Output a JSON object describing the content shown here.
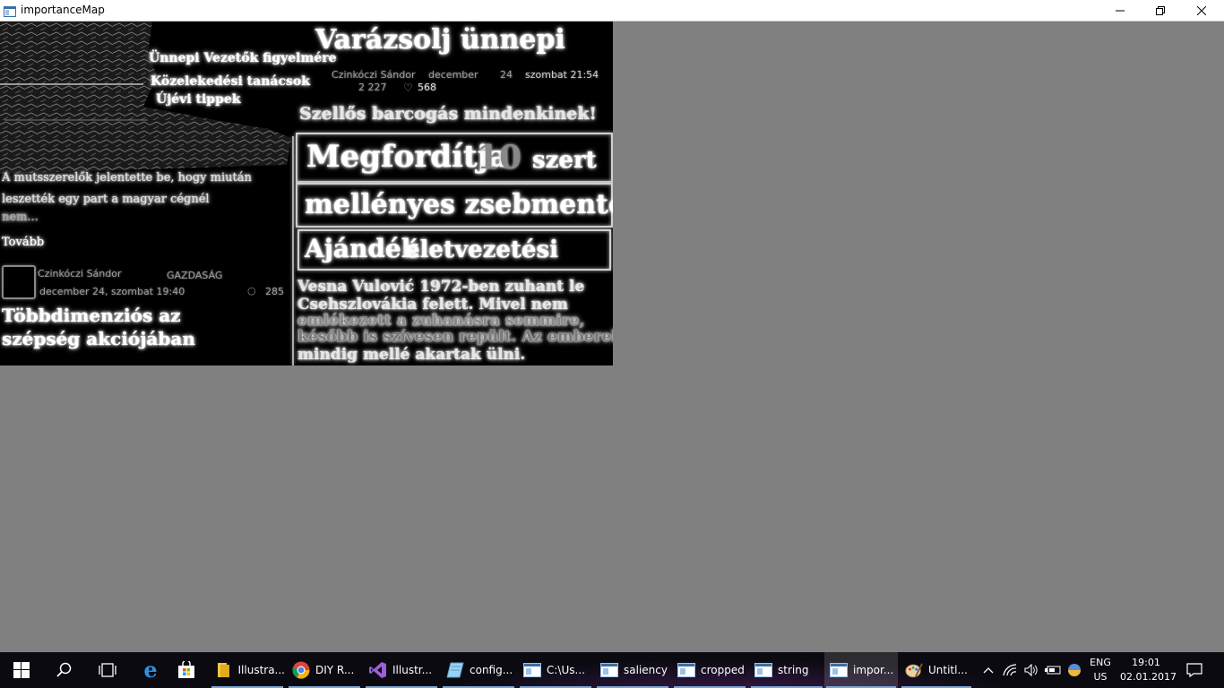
{
  "window": {
    "title": "importanceMap"
  },
  "image_text": {
    "h1": "Varázsolj ünnepi",
    "bl1": "Ünnepi Vezetők figyelmére",
    "bl2": "Közelekedési tanácsok",
    "bl3": "Újévi tippek",
    "author1": "Czinkóczi Sándor",
    "date1": "december",
    "daynum1": "24",
    "day1": "szombat 21:54",
    "n1": "2 227",
    "n2": "568",
    "headline2": "Szellős barcogás mindenkinek!",
    "box1a": "Megfordítja",
    "box1b": "10",
    "box1c": "szert",
    "box2": "mellényes zsebmentő",
    "box3a": "Ajándék",
    "box3b": "életvezetési",
    "para1": "A mutsszerelők jelentette be, hogy miután",
    "para2": "leszették egy part a magyar cégnél",
    "para3": "nem...",
    "more": "Tovább",
    "author2": "Czinkóczi Sándor",
    "category2": "GAZDASÁG",
    "date2": "december 24, szombat 19:40",
    "n3": "285",
    "story1": "Vesna Vulović 1972-ben zuhant le",
    "story2": "Csehszlovákia felett. Mivel nem",
    "story3": "emlékezett a zuhanásra semmire,",
    "story4": "később is szívesen repült. Az emberek",
    "story5": "mindig mellé akartak ülni.",
    "big1": "Többdimenziós az",
    "big2": "szépség akciójában"
  },
  "taskbar": {
    "apps": [
      {
        "label": "Illustra...",
        "icon": "file-explorer-icon"
      },
      {
        "label": "DIY R...",
        "icon": "chrome-icon"
      },
      {
        "label": "Illustr...",
        "icon": "visual-studio-icon"
      },
      {
        "label": "config...",
        "icon": "notepad-icon"
      },
      {
        "label": "C:\\Us...",
        "icon": "app-window-icon"
      },
      {
        "label": "saliency",
        "icon": "app-window-icon"
      },
      {
        "label": "cropped",
        "icon": "app-window-icon"
      },
      {
        "label": "string",
        "icon": "app-window-icon"
      },
      {
        "label": "impor...",
        "icon": "app-window-icon"
      },
      {
        "label": "Untitl...",
        "icon": "paint-icon"
      }
    ],
    "lang_top": "ENG",
    "lang_bottom": "US",
    "time": "19:01",
    "date": "02.01.2017"
  },
  "colors": {
    "desktop_gray": "#808080",
    "taskbar": "#0a0a10",
    "accent_underline": "#7aa7d8"
  }
}
